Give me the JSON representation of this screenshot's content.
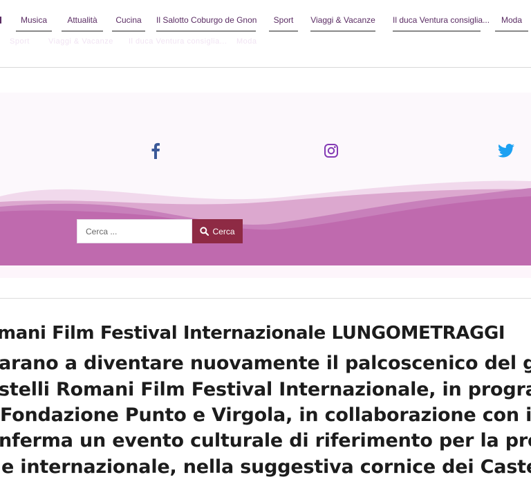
{
  "nav": {
    "items": [
      "Musica",
      "Attualità",
      "Cucina",
      "Il Salotto Coburgo de Gnon",
      "Sport",
      "Viaggi & Vacanze",
      "Il duca Ventura consiglia...",
      "Moda"
    ],
    "ghost": [
      "Sport",
      "Viaggi & Vacanze",
      "Il duca Ventura consiglia...",
      "Moda"
    ]
  },
  "social": {
    "facebook_icon": "facebook-icon",
    "instagram_icon": "instagram-icon",
    "twitter_icon": "twitter-icon"
  },
  "search": {
    "placeholder": "Cerca ...",
    "button_label": "Cerca",
    "button_icon": "search-icon"
  },
  "colors": {
    "brand_purple": "#5a2c63",
    "wave_pink": "#c06aae",
    "button_red": "#8e2a44",
    "twitter_blue": "#1da1f2",
    "facebook_blue": "#3b5998",
    "instagram_purple": "#833ab4"
  },
  "article": {
    "heading": "mani Film Festival Internazionale LUNGOMETRAGGI",
    "lines": [
      "arano a diventare nuovamente il palcoscenico del gra",
      "stelli Romani Film Festival Internazionale, in program",
      "Fondazione Punto e Virgola, in collaborazione con i C",
      "nferma un evento culturale di riferimento per la pron",
      "e internazionale, nella suggestiva cornice dei Castell"
    ]
  }
}
